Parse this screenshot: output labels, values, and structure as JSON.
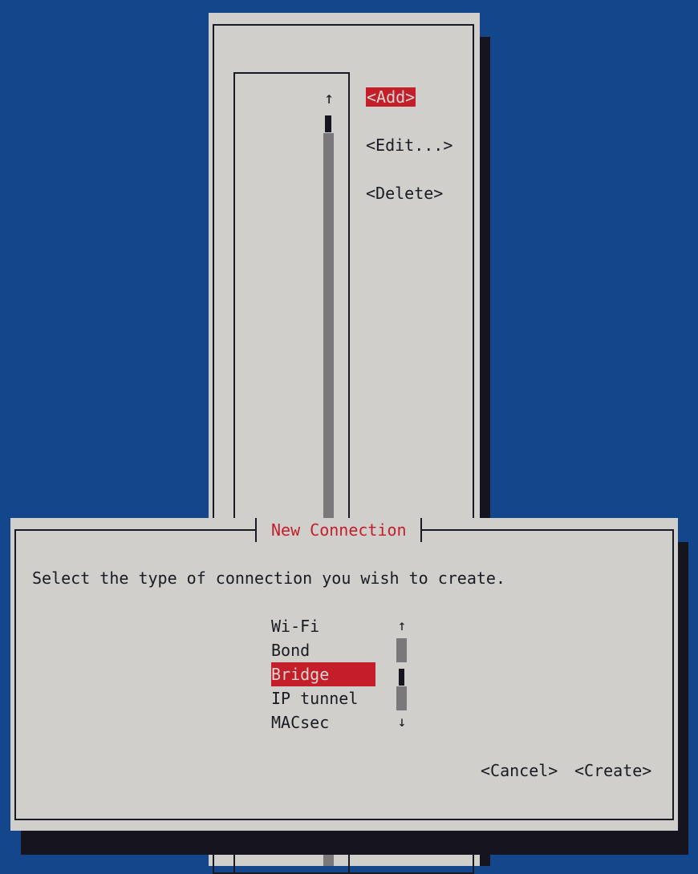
{
  "background_window": {
    "scroll_up_arrow": "↑",
    "buttons": {
      "add": "<Add>",
      "edit": "<Edit...>",
      "delete": "<Delete>"
    }
  },
  "dialog": {
    "title": "New Connection",
    "prompt": "Select the type of connection you wish to create.",
    "connection_types": [
      "Wi-Fi",
      "Bond",
      "Bridge",
      "IP tunnel",
      "MACsec"
    ],
    "selected_type": "Bridge",
    "scroll_up_arrow": "↑",
    "scroll_down_arrow": "↓",
    "buttons": {
      "cancel": "<Cancel>",
      "create": "<Create>"
    }
  },
  "colors": {
    "desktop": "#13468a",
    "window": "#d0cfcb",
    "highlight": "#c41e2a",
    "shadow": "#16151f",
    "scrollbar": "#7a787b"
  }
}
